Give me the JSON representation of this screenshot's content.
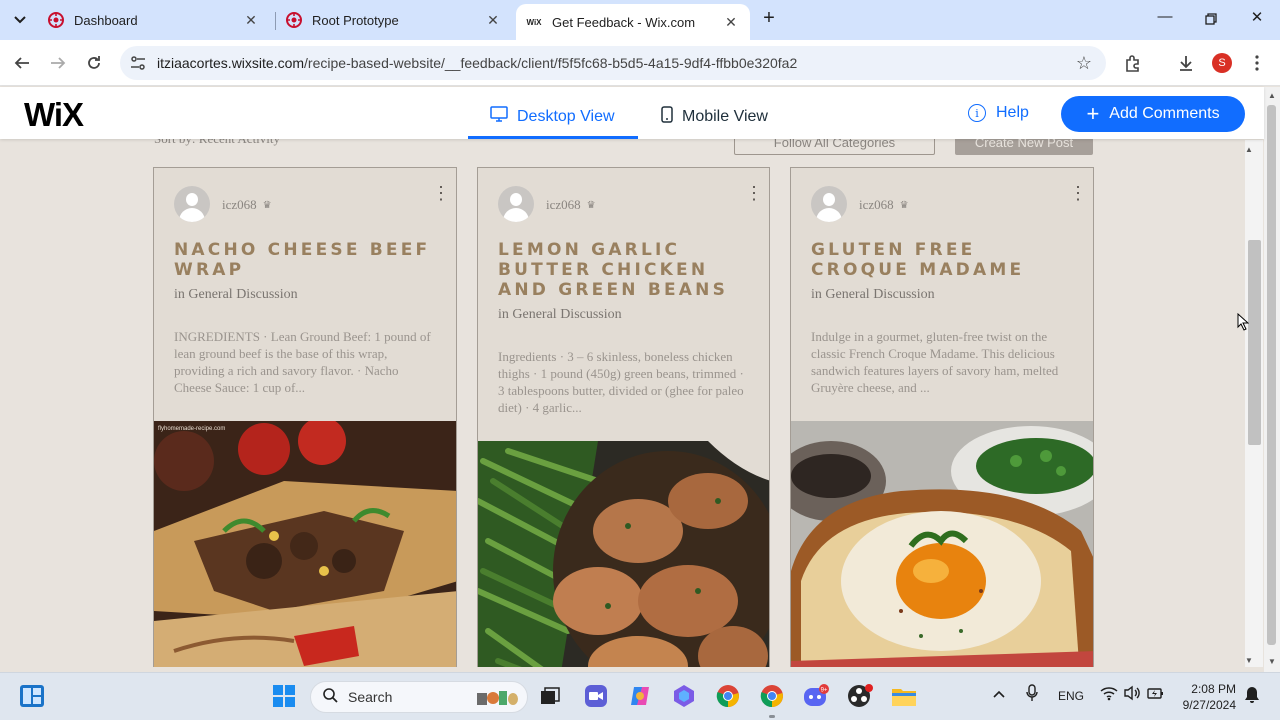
{
  "browser": {
    "tabs": [
      {
        "title": "Dashboard",
        "favicon": "red-circle-icon"
      },
      {
        "title": "Root Prototype",
        "favicon": "red-circle-icon"
      },
      {
        "title": "Get Feedback - Wix.com",
        "favicon": "wix-icon",
        "active": true
      }
    ],
    "url_host": "itziaacortes.wixsite.com",
    "url_path": "/recipe-based-website/__feedback/client/f5f5fc68-b5d5-4a15-9df4-ffbb0e320fa2",
    "profile_initial": "S"
  },
  "wix": {
    "logo": "WiX",
    "desktop_view": "Desktop View",
    "mobile_view": "Mobile View",
    "help": "Help",
    "add_comments": "Add Comments"
  },
  "forum": {
    "sort_by": "Sort by: Recent Activity",
    "follow_all": "Follow All Categories",
    "create_post": "Create New Post",
    "posts": [
      {
        "author": "icz068",
        "title": "Nacho Cheese Beef Wrap",
        "category": "in General Discussion",
        "excerpt": "INGREDIENTS · Lean Ground Beef: 1 pound of lean ground beef is the base of this wrap, providing a rich and savory flavor. · Nacho Cheese Sauce: 1 cup of...",
        "image_caption": "flyhomemade-recipe.com"
      },
      {
        "author": "icz068",
        "title": "Lemon Garlic Butter Chicken and Green Beans",
        "category": "in General Discussion",
        "excerpt": "Ingredients · 3 – 6 skinless, boneless chicken thighs · 1 pound (450g) green beans, trimmed · 3 tablespoons butter, divided or (ghee for paleo diet) · 4 garlic..."
      },
      {
        "author": "icz068",
        "title": "Gluten Free Croque Madame",
        "category": "in General Discussion",
        "excerpt": "Indulge in a gourmet, gluten-free twist on the classic French Croque Madame. This delicious sandwich features layers of savory ham, melted Gruyère cheese, and ..."
      }
    ]
  },
  "taskbar": {
    "search_placeholder": "Search",
    "language": "ENG",
    "time": "2:08 PM",
    "date": "9/27/2024",
    "chat_badge": "9+"
  },
  "colors": {
    "accent": "#116dff",
    "card_bg": "#e2dcd4",
    "title": "#99805f",
    "page_bg": "#e8e3dd"
  }
}
